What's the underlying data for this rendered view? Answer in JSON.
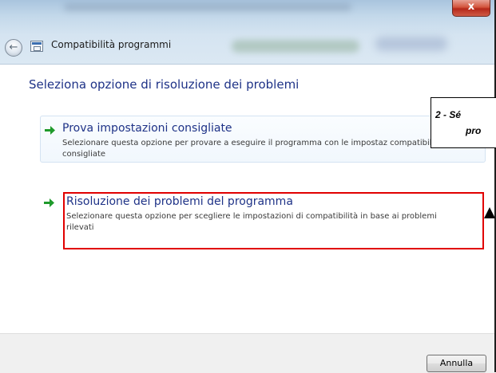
{
  "window": {
    "title": "Compatibilità programmi",
    "close_label": "x"
  },
  "main": {
    "heading": "Seleziona opzione di risoluzione dei problemi",
    "options": [
      {
        "title": "Prova impostazioni consigliate",
        "description": "Selezionare questa opzione per provare a eseguire il programma con le impostaz compatibilità consigliate",
        "icon": "green-arrow-icon"
      },
      {
        "title": "Risoluzione dei problemi del programma",
        "description": "Selezionare questa opzione per scegliere le impostazioni di compatibilità in base ai problemi rilevati",
        "icon": "green-arrow-icon",
        "highlighted": true
      }
    ]
  },
  "annotation": {
    "line1": "2 - Sé",
    "line2": "pro"
  },
  "footer": {
    "cancel_label": "Annulla"
  },
  "colors": {
    "heading_blue": "#1e3287",
    "highlight_red": "#e10000",
    "arrow_green": "#1f9a2b"
  }
}
